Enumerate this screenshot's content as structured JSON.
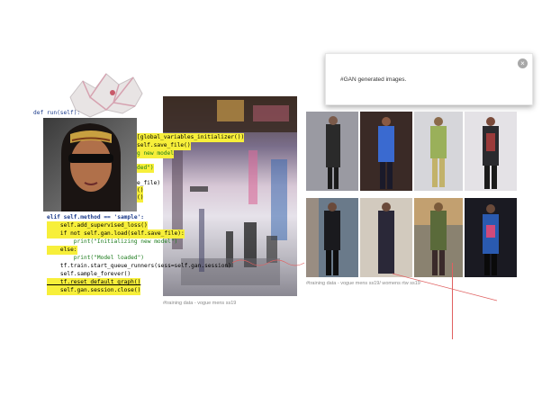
{
  "tooltip": {
    "text": "#GAN generated images."
  },
  "captions": {
    "left": "#training data - vogue mens ss19",
    "right": "#training data - vogue mens ss19/ womens rtw ss19"
  },
  "code": {
    "l_def": "def run(self):",
    "l_glob": "[global_variables_initializer())",
    "l_save": "self.save_file()",
    "l_new": "g new model",
    "l_ded": "ded\")",
    "l_efile": "e_file)",
    "l_p1": "()",
    "l_p2": "()",
    "l_elif": "elif self.method == 'sample':",
    "l_sup": "    self.add_supervised_loss()",
    "l_ifnot": "    if not self.gan.load(self.save_file):",
    "l_print1": "        print(\"Initializing new model\")",
    "l_else": "    else:",
    "l_print2": "        print(\"Model loaded\")",
    "l_tf": "    tf.train.start_queue_runners(sess=self.gan.session)",
    "l_sample": "    self.sample_forever()",
    "l_reset": "    tf.reset_default_graph()",
    "l_close": "    self.gan.session.close()"
  },
  "colors": {
    "highlight": "#f7ef3a",
    "accent_red": "#e06060",
    "keyword": "#1a3a8a",
    "string": "#1a7a1a"
  }
}
